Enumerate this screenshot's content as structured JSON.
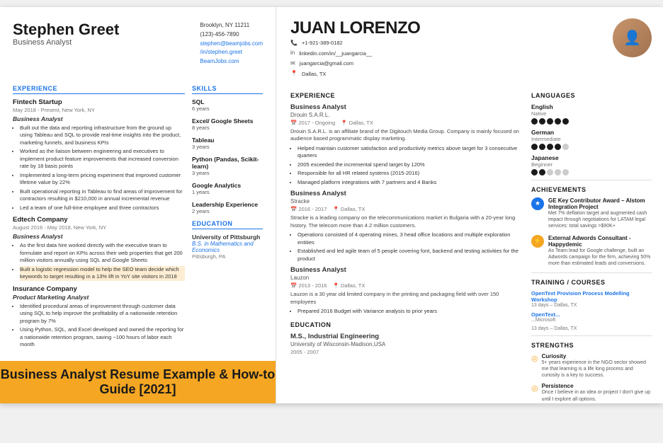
{
  "leftResume": {
    "name": "Stephen Greet",
    "title": "Business Analyst",
    "contactInfo": {
      "address": "Brooklyn, NY 11211",
      "phone": "(123)-456-7890",
      "email": "stephen@beamjobs.com",
      "portfolio": "/in/stephen.greet",
      "website": "BeamJobs.com"
    },
    "experience": {
      "label": "EXPERIENCE",
      "companies": [
        {
          "name": "Fintech Startup",
          "location": "May 2018 - Present, New York, NY",
          "role": "Business Analyst",
          "bullets": [
            "Built out the data and reporting infrastructure from the ground up using Tableau and SQL to provide real-time insights into the product, marketing funnels, and business KPIs",
            "Worked as the liaison between engineering and executives to implement product feature improvements that increased conversion rate by 18 basis points",
            "Implemented a long-term pricing experiment that improved customer lifetime value by 22%",
            "Built operational reporting in Tableau to find areas of improvement for contractors resulting in $210,000 in annual incremental revenue",
            "Led a team of one full-time employee and three contractors"
          ]
        },
        {
          "name": "Edtech Company",
          "location": "August 2016 - May 2018, New York, NY",
          "role": "Business Analyst",
          "bullets": [
            "As the first data hire worked directly with the executive team to formulate and report on KPIs across their web properties that get 200 million visitors annually using SQL and Google Sheets",
            "Built a logistic regression model to help the SEO team decide which keywords to target resulting in a 13% lift in YoY site visitors in 2018"
          ]
        },
        {
          "name": "Insurance Company",
          "location": "",
          "role": "Product Marketing Analyst",
          "bullets": [
            "Identified procedural areas of improvement through customer data using SQL to help improve the profitability of a nationwide retention program by 7%",
            "Using Python, SQL, and Excel developed and owned the reporting for a nationwide retention program, saving ~100 hours of labor each month"
          ]
        }
      ]
    },
    "skills": {
      "label": "SKILLS",
      "items": [
        {
          "name": "SQL",
          "years": "6 years"
        },
        {
          "name": "Excel/ Google Sheets",
          "years": "8 years"
        },
        {
          "name": "Tableau",
          "years": "3 years"
        },
        {
          "name": "Python (Pandas, Scikit-learn)",
          "years": "3 years"
        },
        {
          "name": "Google Analytics",
          "years": "1 years"
        },
        {
          "name": "Leadership Experience",
          "years": "2 years"
        }
      ]
    },
    "education": {
      "label": "EDUCATION",
      "school": "University of Pittsburgh",
      "degree": "B.S. in Mathematics and Economics",
      "location": "Pittsburgh, PA"
    }
  },
  "rightResume": {
    "name": "JUAN LORENZO",
    "contact": {
      "phone": "+1-921-389-0182",
      "linkedin": "linkedin.com/in/__juangarcia__",
      "email": "juangarcia@gmail.com",
      "location": "Dallas, TX"
    },
    "experience": {
      "label": "EXPERIENCE",
      "companies": [
        {
          "name": "Business Analyst",
          "company": "Drouin S.A.R.L.",
          "dates": "2017 - Ongoing",
          "location": "Dallas, TX",
          "desc": "Drouin S.A.R.L. is an affiliate brand of the Digitouch Media Group. Company is mainly focused on audience based programmatic display marketing.",
          "bullets": [
            "Helped maintain customer satisfaction and productivity metrics above target for 3 consecutive quarters",
            "2005 exceeded the incremental spend target by 120%",
            "Responsible for all HR related systems (2015-2016)",
            "Managed platform integrations with 7 partners and 4 Banks"
          ]
        },
        {
          "name": "Business Analyst",
          "company": "Stracke",
          "dates": "2016 - 2017",
          "location": "Dallas, TX",
          "desc": "Stracke is a leading company on the telecommunications market in Bulgaria with a 20-year long history. The telecom more than 4.2 million customers.",
          "bullets": [
            "Operations consisted of 4 operating mines, 3 head office locations and multiple exploration entities",
            "Established and led agile team of 5 people covering font, backend and testing activities for the product"
          ]
        },
        {
          "name": "Business Analyst",
          "company": "Lauzon",
          "dates": "2013 - 2016",
          "location": "Dallas, TX",
          "desc": "Lauzon is a 30 year old limited company in the printing and packaging field with over 150 employees",
          "bullets": [
            "Prepared 2016 Budget with Variance analysis to prior years"
          ]
        }
      ]
    },
    "education": {
      "label": "EDUCATION",
      "degree": "M.S., Industrial Engineering",
      "school": "University of Wisconsin-Madison,USA",
      "dates": "2005 - 2007"
    },
    "languages": {
      "label": "LANGUAGES",
      "items": [
        {
          "name": "English",
          "level": "Native",
          "dots": 5
        },
        {
          "name": "German",
          "level": "Intermediate",
          "dots": 4
        },
        {
          "name": "Japanese",
          "level": "Beginner",
          "dots": 2
        }
      ]
    },
    "achievements": {
      "label": "ACHIEVEMENTS",
      "items": [
        {
          "icon": "★",
          "iconStyle": "blue",
          "title": "GE Key Contributor Award – Alstom Integration Project",
          "desc": "Met 7% deflation target and augmented cash impact through negotiations for LATAM legal services: total savings >$90K+"
        },
        {
          "icon": "⚡",
          "iconStyle": "orange",
          "title": "External Adwords Consultant - Happydemic",
          "desc": "As Team lead for Google challenge, built an Adwords campaign for the firm, achieving 50% more than estimated leads and conversions."
        }
      ]
    },
    "training": {
      "label": "TRAINING / COURSES",
      "items": [
        {
          "title": "OpenText Provision Process Modelling Workshop",
          "meta": "13 days – Dallas, TX"
        },
        {
          "title": "OpenText...",
          "meta": "...Microsoft"
        },
        {
          "title": "13 days – Dallas, TX",
          "meta": ""
        }
      ]
    },
    "strengths": {
      "label": "STRENGTHS",
      "items": [
        {
          "icon": "◎",
          "title": "Curiosity",
          "desc": "5+ years experience in the NGO sector showed me that learning is a life long process and curiosity is a key to success."
        },
        {
          "icon": "◎",
          "title": "Persistence",
          "desc": "Once I believe in an idea or project I don't give up until I explore all options."
        }
      ]
    }
  },
  "banner": {
    "text": "Business Analyst Resume Example & How-to Guide [2021]"
  }
}
